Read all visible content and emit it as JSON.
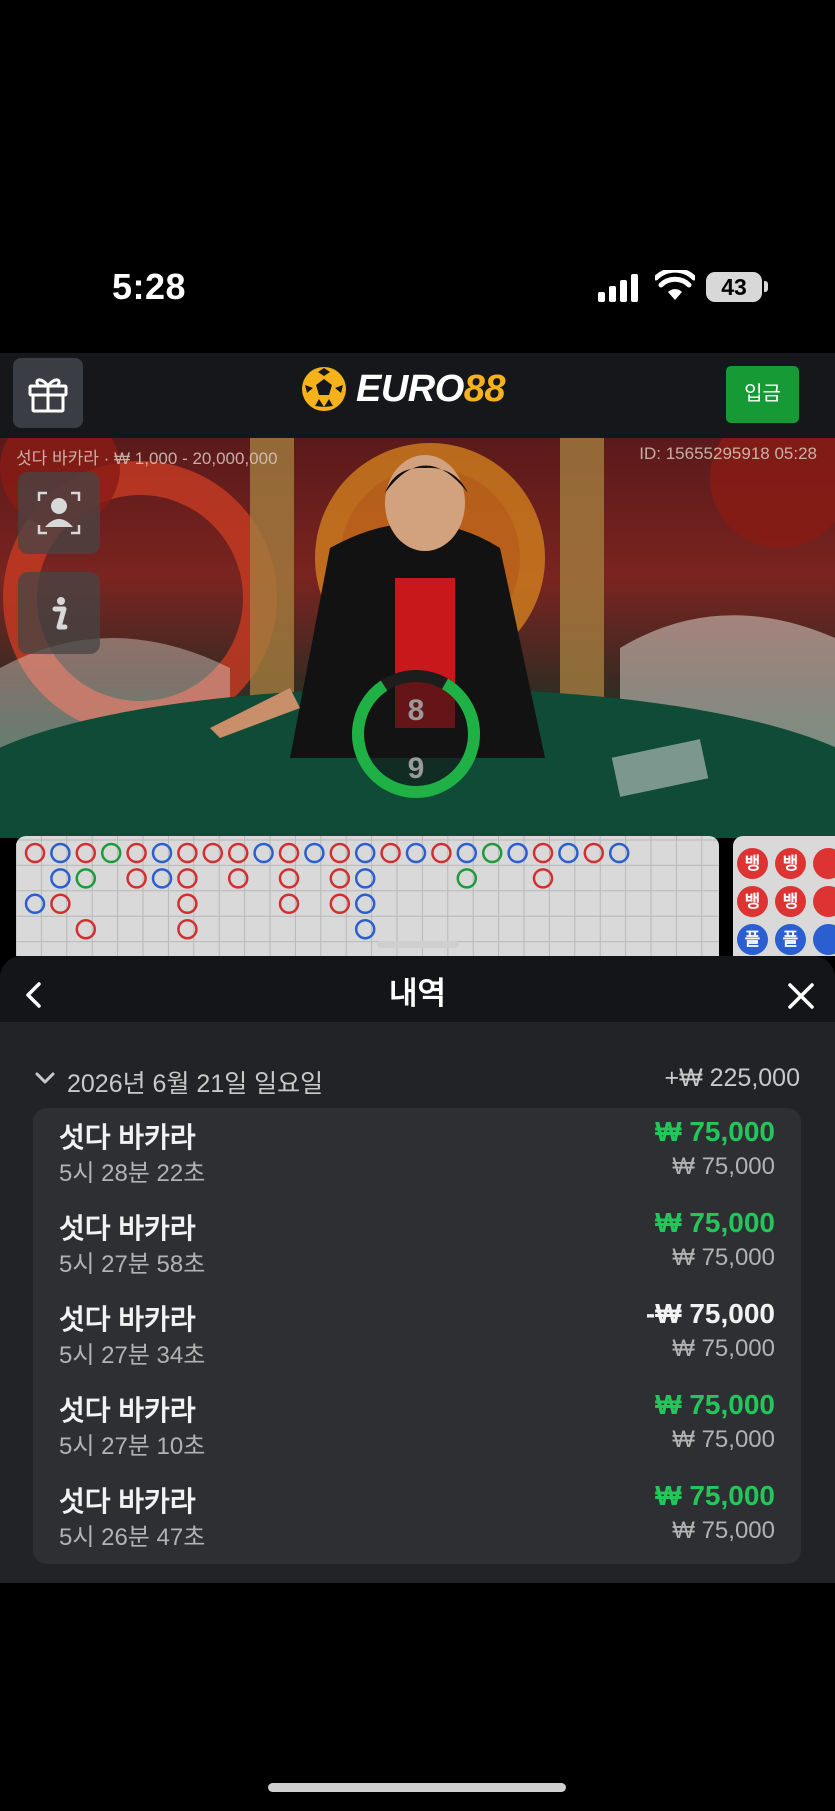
{
  "status_bar": {
    "time": "5:28",
    "battery": "43"
  },
  "header": {
    "logo_main": "EURO",
    "logo_accent": "88",
    "deposit_label": "입금",
    "colors": {
      "accent": "#f6b21b",
      "deposit": "#169a36"
    }
  },
  "video": {
    "table_info": "섯다 바카라 · ₩ 1,000 - 20,000,000",
    "round_id": "ID: 15655295918 05:28",
    "timer_top": "8",
    "timer_bottom": "9"
  },
  "bead_road": [
    "뱅",
    "뱅",
    "뱅",
    "뱅",
    "플",
    "플"
  ],
  "sheet": {
    "title": "내역",
    "date_label": "2026년 6월 21일 일요일",
    "date_total": "+₩ 225,000",
    "entries": [
      {
        "game": "섯다 바카라",
        "time": "5시 28분 22초",
        "amount": "₩ 75,000",
        "bet": "₩ 75,000",
        "result": "win"
      },
      {
        "game": "섯다 바카라",
        "time": "5시 27분 58초",
        "amount": "₩ 75,000",
        "bet": "₩ 75,000",
        "result": "win"
      },
      {
        "game": "섯다 바카라",
        "time": "5시 27분 34초",
        "amount": "-₩ 75,000",
        "bet": "₩ 75,000",
        "result": "loss"
      },
      {
        "game": "섯다 바카라",
        "time": "5시 27분 10초",
        "amount": "₩ 75,000",
        "bet": "₩ 75,000",
        "result": "win"
      },
      {
        "game": "섯다 바카라",
        "time": "5시 26분 47초",
        "amount": "₩ 75,000",
        "bet": "₩ 75,000",
        "result": "win"
      }
    ],
    "colors": {
      "win": "#23c65a",
      "loss": "#f2f2f2"
    }
  }
}
